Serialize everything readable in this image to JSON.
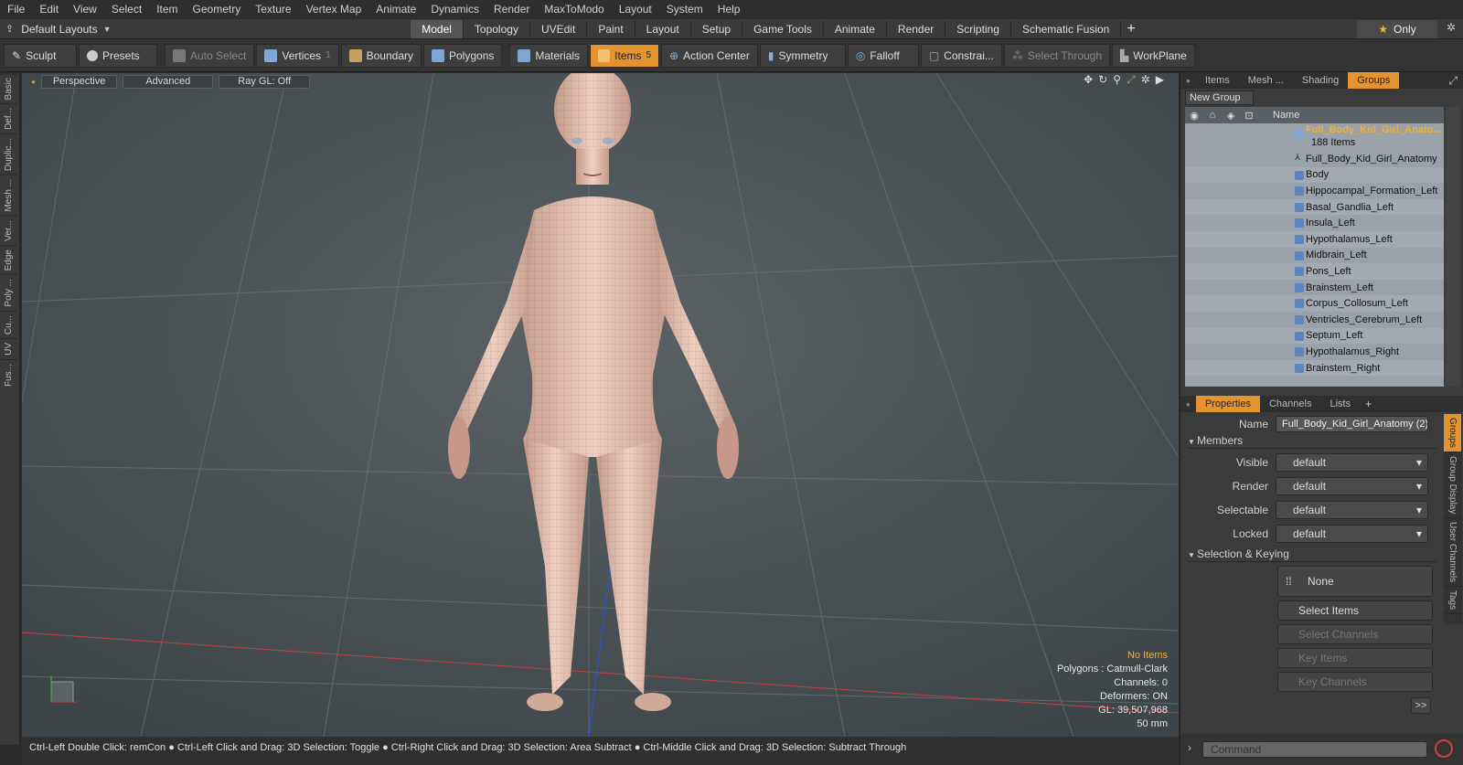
{
  "menu": [
    "File",
    "Edit",
    "View",
    "Select",
    "Item",
    "Geometry",
    "Texture",
    "Vertex Map",
    "Animate",
    "Dynamics",
    "Render",
    "MaxToModo",
    "Layout",
    "System",
    "Help"
  ],
  "layout": {
    "dropdown": "Default Layouts",
    "tabs": [
      "Model",
      "Topology",
      "UVEdit",
      "Paint",
      "Layout",
      "Setup",
      "Game Tools",
      "Animate",
      "Render",
      "Scripting",
      "Schematic Fusion"
    ],
    "active_tab": "Model",
    "only_label": "Only"
  },
  "toolbar": {
    "sculpt": "Sculpt",
    "presets": "Presets",
    "auto_select": "Auto Select",
    "vertices": "Vertices",
    "vertices_count": "1",
    "boundary": "Boundary",
    "polygons": "Polygons",
    "materials": "Materials",
    "items": "Items",
    "items_count": "5",
    "action_center": "Action Center",
    "symmetry": "Symmetry",
    "falloff": "Falloff",
    "constraints": "Constrai...",
    "select_through": "Select Through",
    "workplane": "WorkPlane"
  },
  "left_tabs": [
    "Basic",
    "Def...",
    "Duplic...",
    "Mesh ...",
    "Ver...",
    "Edge",
    "Poly ...",
    "Cu...",
    "UV",
    "Fus..."
  ],
  "viewport": {
    "view": "Perspective",
    "mode": "Advanced",
    "raygl": "Ray GL: Off",
    "info": {
      "items": "No Items",
      "polygons": "Polygons : Catmull-Clark",
      "channels": "Channels: 0",
      "deformers": "Deformers: ON",
      "gl": "GL: 39,507,968",
      "scale": "50 mm"
    }
  },
  "statusbar": "Ctrl-Left Double Click: remCon ● Ctrl-Left Click and Drag: 3D Selection: Toggle ● Ctrl-Right Click and Drag: 3D Selection: Area Subtract ● Ctrl-Middle Click and Drag: 3D Selection: Subtract Through",
  "right": {
    "tabs": [
      "Items",
      "Mesh ...",
      "Shading",
      "Groups"
    ],
    "active_tab": "Groups",
    "new_group": "New Group",
    "tree_header": "Name",
    "group_name": "Full_Body_Kid_Girl_Anato...",
    "group_count": "188 Items",
    "tree_items": [
      "Full_Body_Kid_Girl_Anatomy",
      "Body",
      "Hippocampal_Formation_Left",
      "Basal_Gandlia_Left",
      "Insula_Left",
      "Hypothalamus_Left",
      "Midbrain_Left",
      "Pons_Left",
      "Brainstem_Left",
      "Corpus_Collosum_Left",
      "Ventricles_Cerebrum_Left",
      "Septum_Left",
      "Hypothalamus_Right",
      "Brainstem_Right"
    ]
  },
  "properties": {
    "tabs": [
      "Properties",
      "Channels",
      "Lists"
    ],
    "active_tab": "Properties",
    "name_label": "Name",
    "name_value": "Full_Body_Kid_Girl_Anatomy (2)",
    "members_section": "Members",
    "visible_label": "Visible",
    "visible_value": "default",
    "render_label": "Render",
    "render_value": "default",
    "selectable_label": "Selectable",
    "selectable_value": "default",
    "locked_label": "Locked",
    "locked_value": "default",
    "selection_section": "Selection & Keying",
    "none_btn": "None",
    "select_items": "Select Items",
    "select_channels": "Select Channels",
    "key_items": "Key Items",
    "key_channels": "Key Channels",
    "side_tabs": [
      "Groups",
      "Group Display",
      "User Channels",
      "Tags"
    ],
    "more": ">>"
  },
  "command": {
    "placeholder": "Command"
  }
}
